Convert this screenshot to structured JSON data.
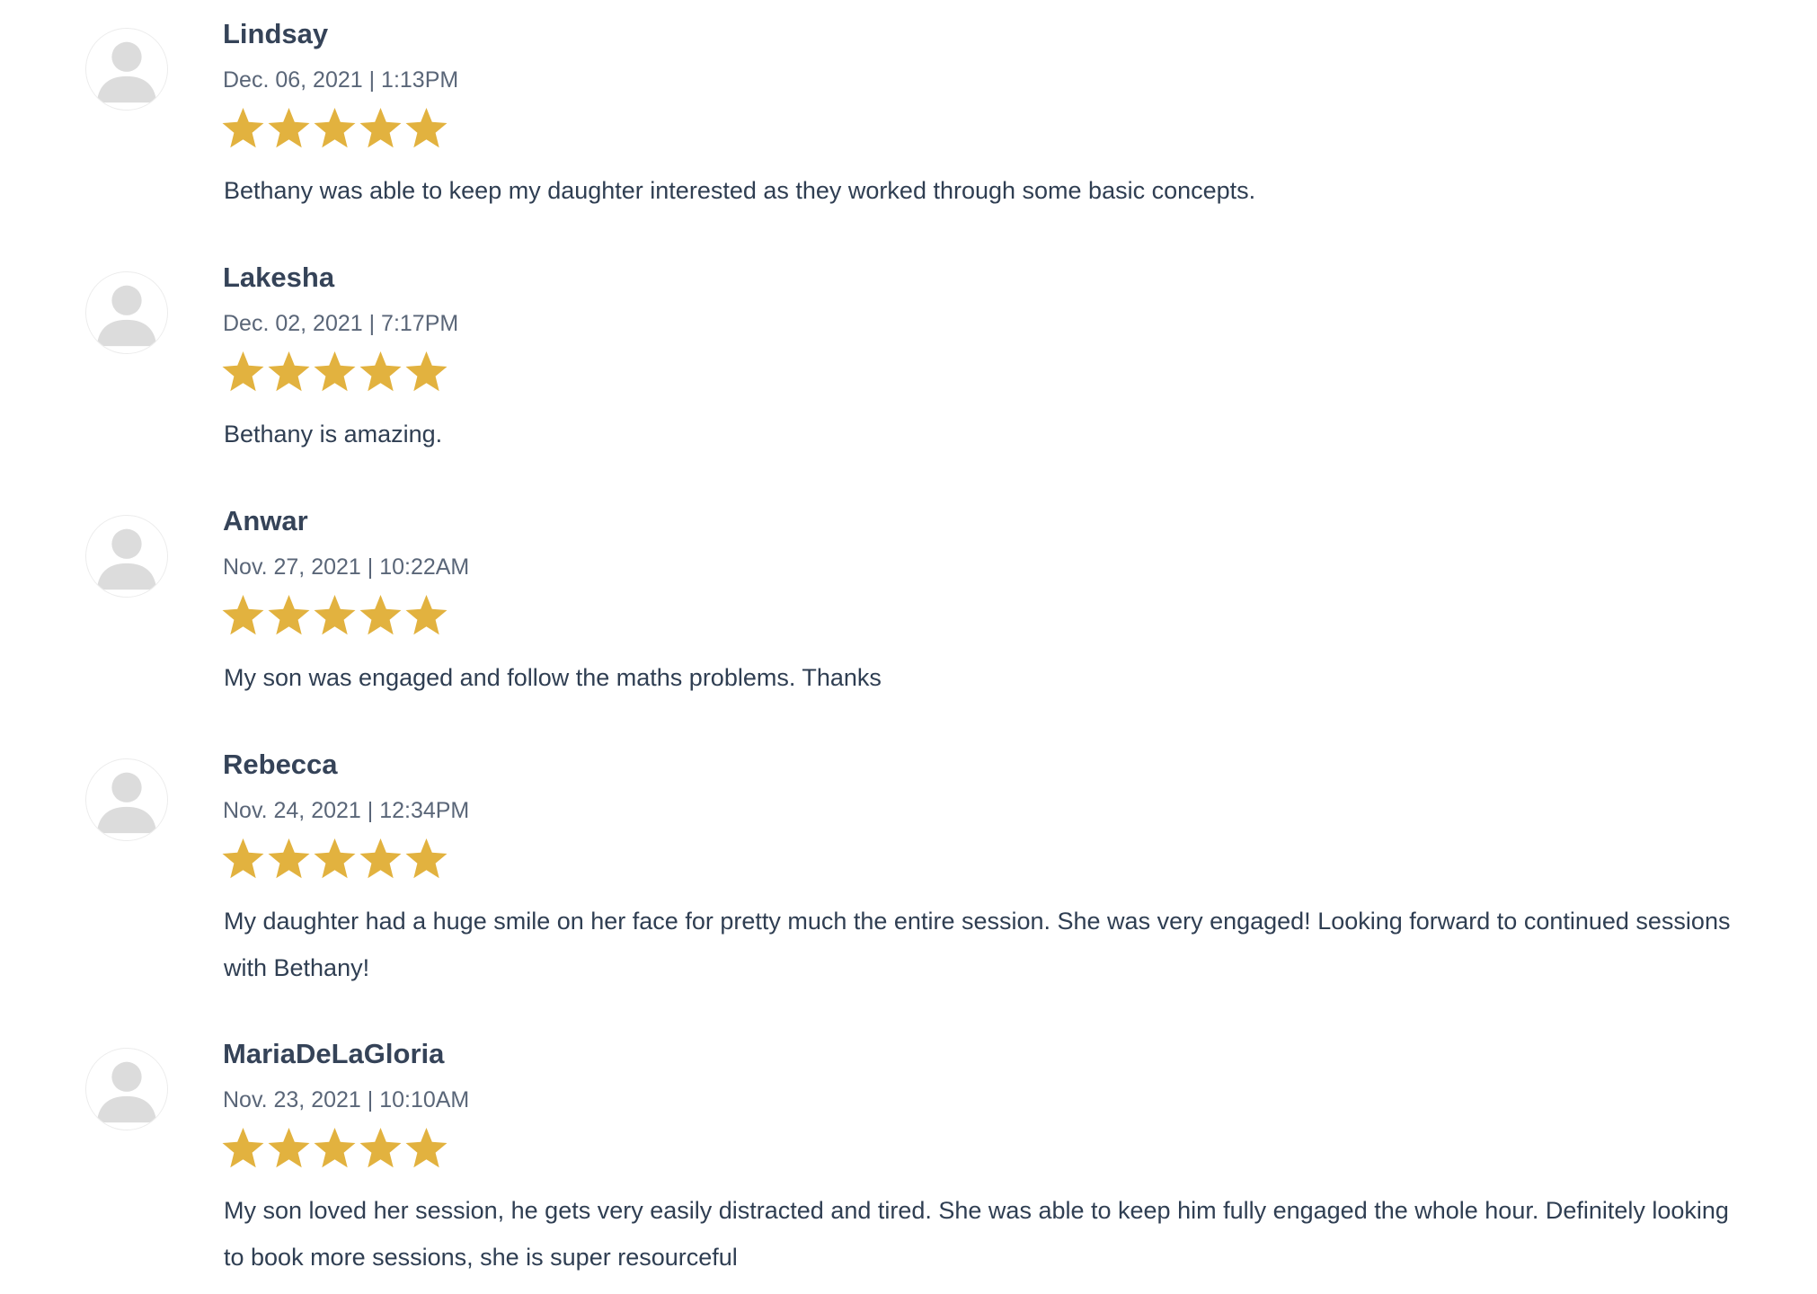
{
  "reviews": [
    {
      "name": "Lindsay",
      "date": "Dec. 06, 2021 | 1:13PM",
      "rating": 5,
      "avatar_icon": "user-silhouette-icon",
      "comment": "Bethany was able to keep my daughter interested as they worked through some basic concepts."
    },
    {
      "name": "Lakesha",
      "date": "Dec. 02, 2021 | 7:17PM",
      "rating": 5,
      "avatar_icon": "user-silhouette-icon",
      "comment": "Bethany is amazing."
    },
    {
      "name": "Anwar",
      "date": "Nov. 27, 2021 | 10:22AM",
      "rating": 5,
      "avatar_icon": "user-silhouette-icon",
      "comment": "My son was engaged and follow the maths problems. Thanks"
    },
    {
      "name": "Rebecca",
      "date": "Nov. 24, 2021 | 12:34PM",
      "rating": 5,
      "avatar_icon": "user-silhouette-icon",
      "comment": "My daughter had a huge smile on her face for pretty much the entire session. She was very engaged! Looking forward to continued sessions with Bethany!"
    },
    {
      "name": "MariaDeLaGloria",
      "date": "Nov. 23, 2021 | 10:10AM",
      "rating": 5,
      "avatar_icon": "user-silhouette-icon",
      "comment": "My son loved her session, he gets very easily distracted and tired. She was able to keep him fully engaged the whole hour. Definitely looking to book more sessions, she is super resourceful"
    }
  ],
  "colors": {
    "star": "#e2b23f",
    "name": "#354358",
    "date": "#5a6678",
    "text": "#2f3e52",
    "avatar_figure": "#dcdcdc"
  }
}
